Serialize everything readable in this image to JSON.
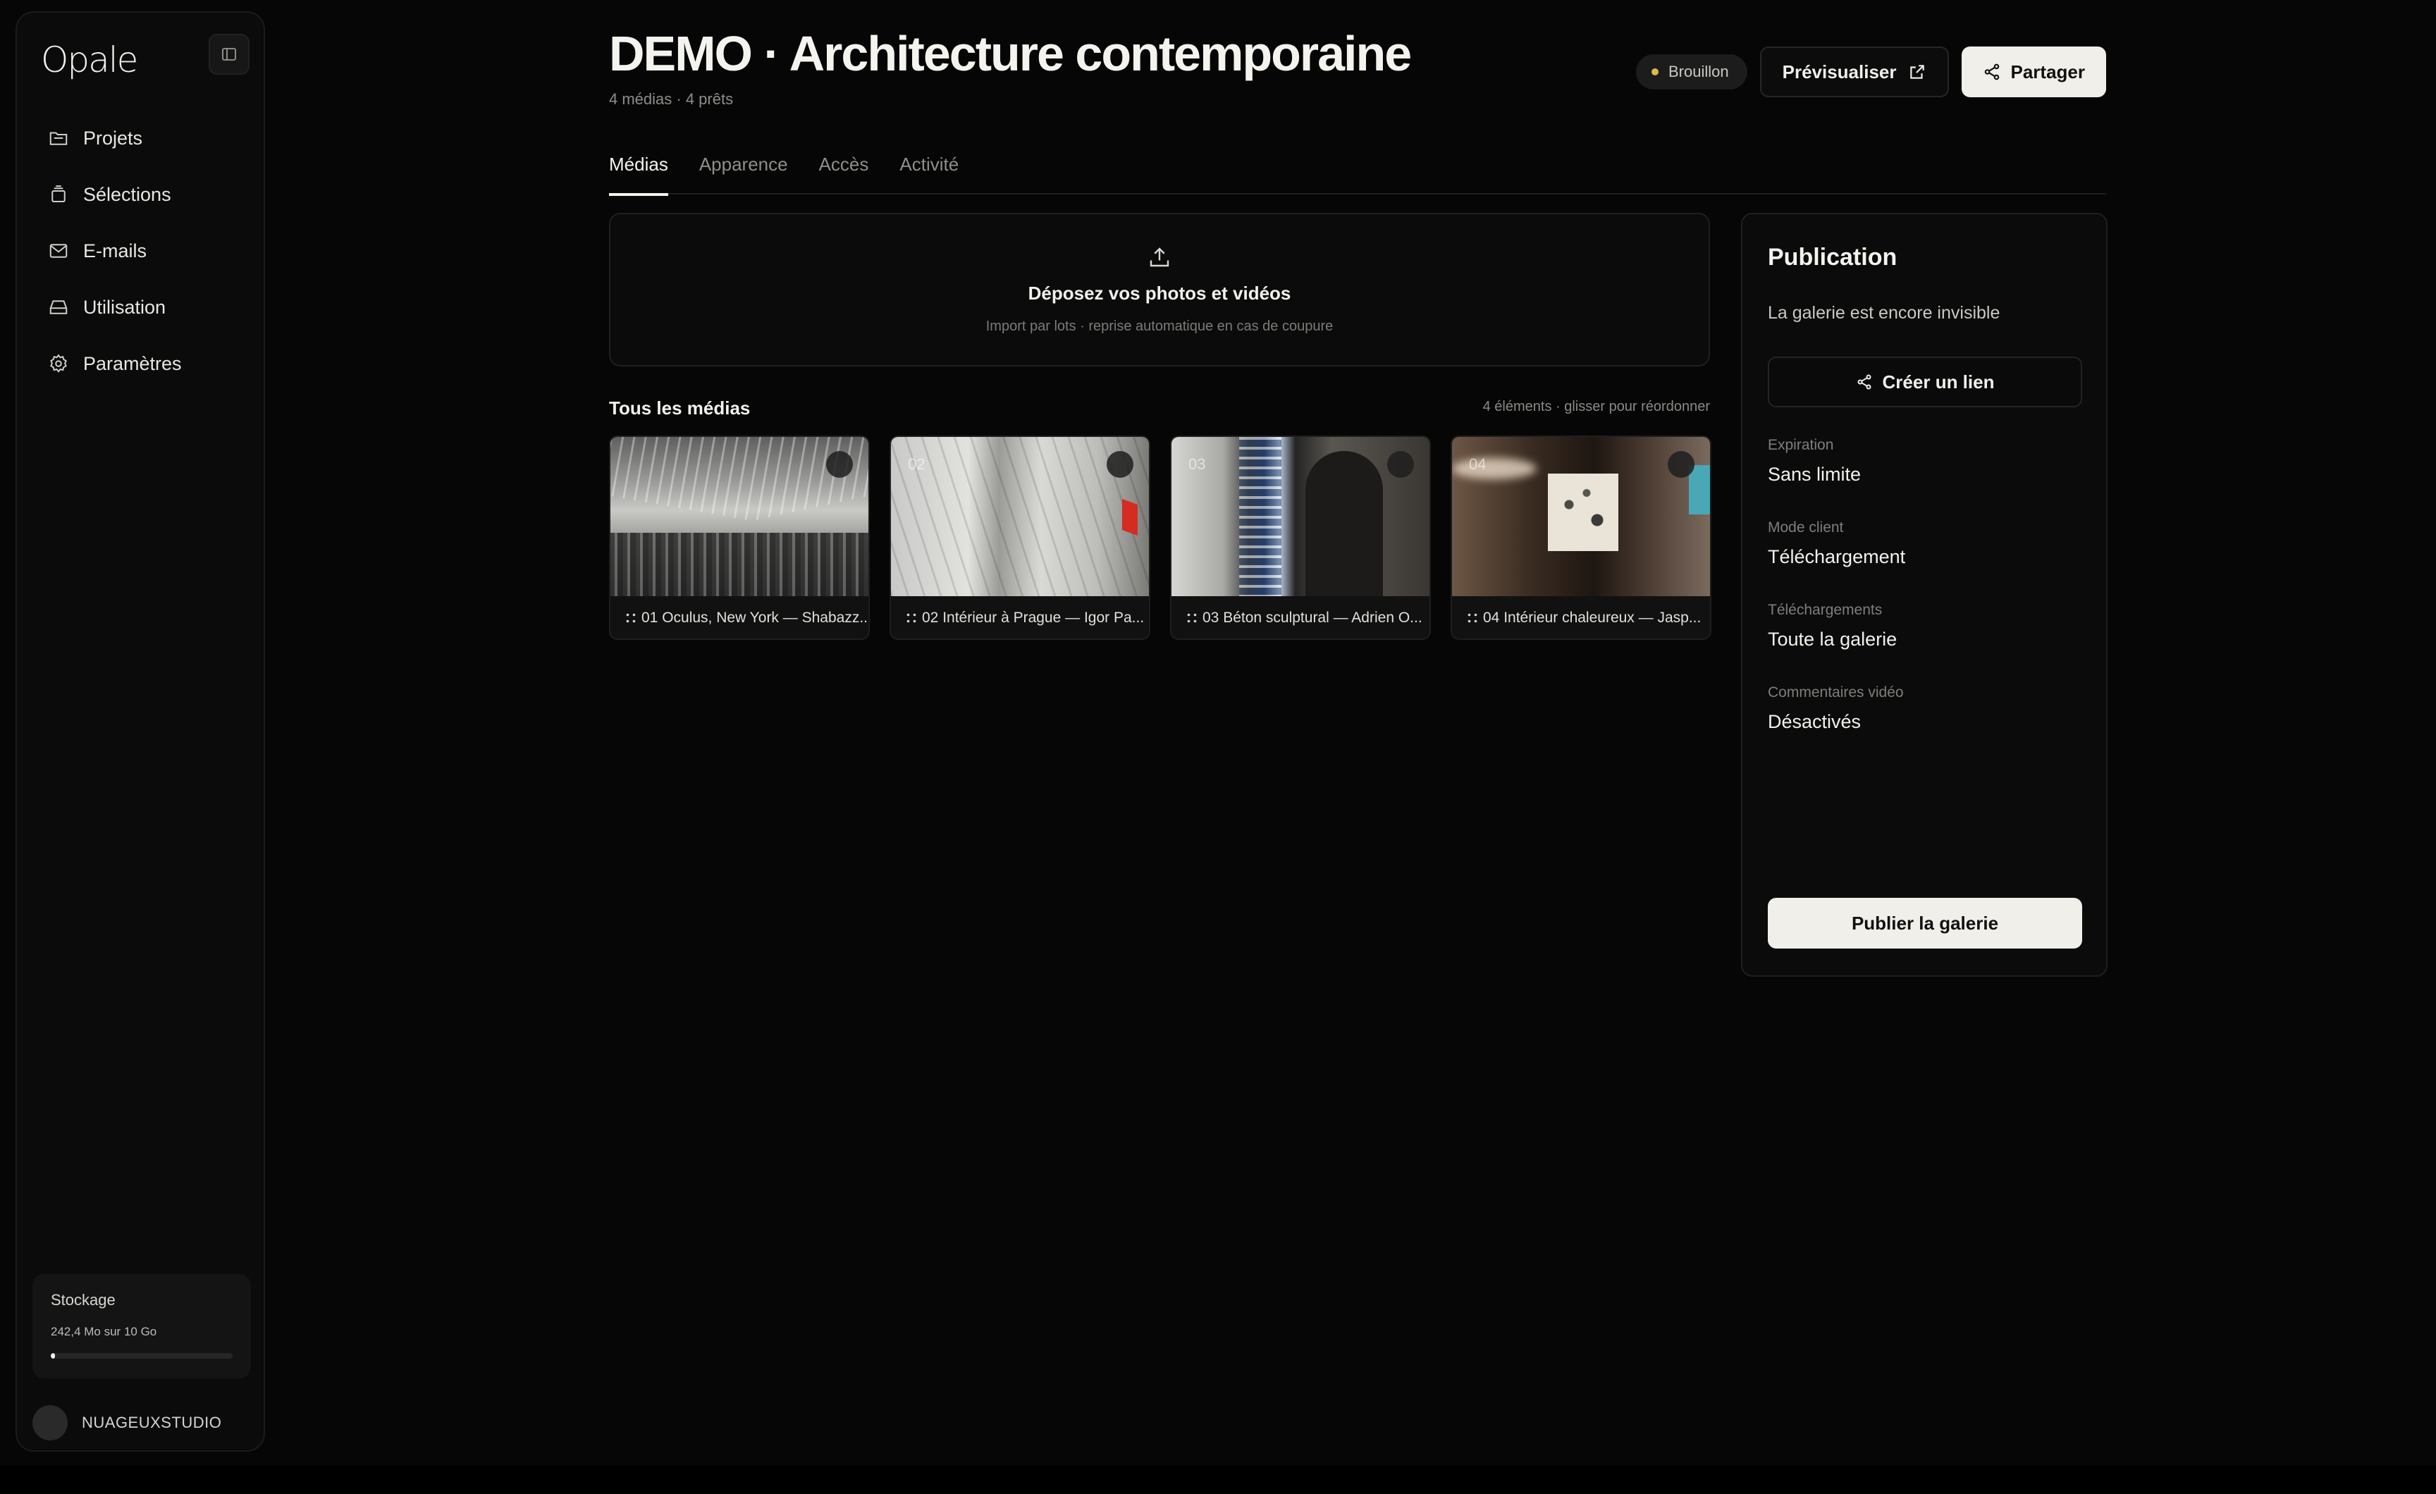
{
  "brand": {
    "name": "Opale"
  },
  "sidebar": {
    "items": [
      {
        "label": "Projets",
        "icon": "folder-icon"
      },
      {
        "label": "Sélections",
        "icon": "stack-icon"
      },
      {
        "label": "E-mails",
        "icon": "mail-icon"
      },
      {
        "label": "Utilisation",
        "icon": "drive-icon"
      },
      {
        "label": "Paramètres",
        "icon": "gear-icon"
      }
    ],
    "storage": {
      "title": "Stockage",
      "value": "242,4 Mo sur 10 Go",
      "used_fraction": 0.024
    },
    "user": {
      "name": "NUAGEUXSTUDIO"
    }
  },
  "header": {
    "title": "DEMO · Architecture contemporaine",
    "subtitle": "4 médias · 4 prêts",
    "status": "Brouillon",
    "status_color": "#e0b84e",
    "preview_label": "Prévisualiser",
    "share_label": "Partager"
  },
  "tabs": [
    {
      "label": "Médias",
      "active": true
    },
    {
      "label": "Apparence",
      "active": false
    },
    {
      "label": "Accès",
      "active": false
    },
    {
      "label": "Activité",
      "active": false
    }
  ],
  "dropzone": {
    "title": "Déposez vos photos et vidéos",
    "hint": "Import par lots · reprise automatique en cas de coupure"
  },
  "media": {
    "title": "Tous les médias",
    "meta": "4 éléments · glisser pour réordonner",
    "items": [
      {
        "num": "01",
        "caption": "01 Oculus, New York — Shabazz..."
      },
      {
        "num": "02",
        "caption": "02 Intérieur à Prague — Igor Pa..."
      },
      {
        "num": "03",
        "caption": "03 Béton sculptural — Adrien O..."
      },
      {
        "num": "04",
        "caption": "04 Intérieur chaleureux — Jasp..."
      }
    ]
  },
  "publication": {
    "title": "Publication",
    "status": "La galerie est encore invisible",
    "link_label": "Créer un lien",
    "settings": [
      {
        "label": "Expiration",
        "value": "Sans limite"
      },
      {
        "label": "Mode client",
        "value": "Téléchargement"
      },
      {
        "label": "Téléchargements",
        "value": "Toute la galerie"
      },
      {
        "label": "Commentaires vidéo",
        "value": "Désactivés"
      }
    ],
    "publish_label": "Publier la galerie"
  }
}
